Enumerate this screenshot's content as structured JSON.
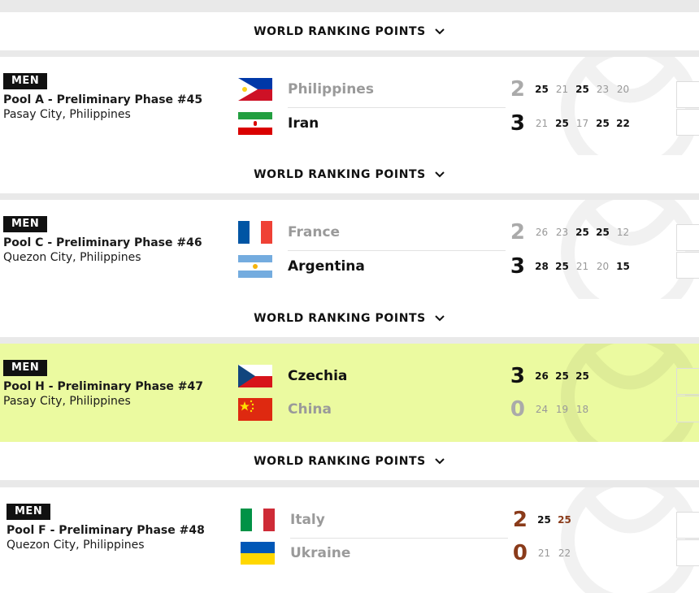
{
  "wrp_label": "WORLD RANKING POINTS",
  "matches": [
    {
      "badge": "MEN",
      "title": "Pool A - Preliminary Phase #45",
      "venue": "Pasay City, Philippines",
      "team1": {
        "name": "Philippines",
        "score": "2",
        "sets": [
          "25",
          "21",
          "25",
          "23",
          "20"
        ]
      },
      "team2": {
        "name": "Iran",
        "score": "3",
        "sets": [
          "21",
          "25",
          "17",
          "25",
          "22"
        ]
      }
    },
    {
      "badge": "MEN",
      "title": "Pool C - Preliminary Phase #46",
      "venue": "Quezon City, Philippines",
      "team1": {
        "name": "France",
        "score": "2",
        "sets": [
          "26",
          "23",
          "25",
          "25",
          "12"
        ]
      },
      "team2": {
        "name": "Argentina",
        "score": "3",
        "sets": [
          "28",
          "25",
          "21",
          "20",
          "15"
        ]
      }
    },
    {
      "badge": "MEN",
      "title": "Pool H - Preliminary Phase #47",
      "venue": "Pasay City, Philippines",
      "team1": {
        "name": "Czechia",
        "score": "3",
        "sets": [
          "26",
          "25",
          "25"
        ]
      },
      "team2": {
        "name": "China",
        "score": "0",
        "sets": [
          "24",
          "19",
          "18"
        ]
      }
    },
    {
      "badge": "MEN",
      "title": "Pool F - Preliminary Phase #48",
      "venue": "Quezon City, Philippines",
      "team1": {
        "name": "Italy",
        "score": "2",
        "sets": [
          "25",
          "25"
        ]
      },
      "team2": {
        "name": "Ukraine",
        "score": "0",
        "sets": [
          "21",
          "22"
        ]
      }
    }
  ],
  "colors": {
    "highlight": "#ebfaa0",
    "badge_bg": "#111111",
    "live_score": "#8a3b1a"
  }
}
